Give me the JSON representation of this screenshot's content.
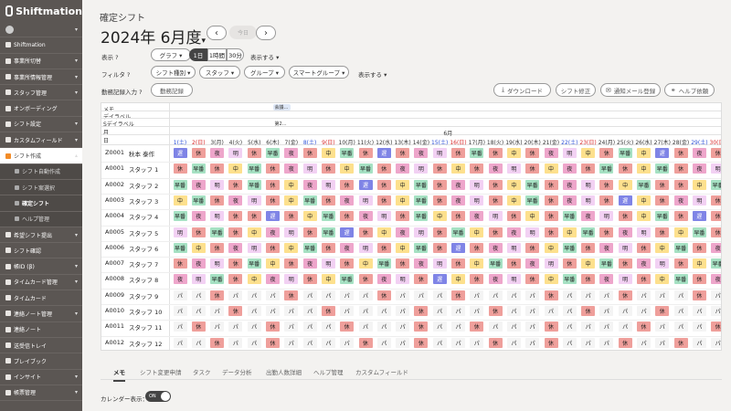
{
  "sidebar": {
    "brand": "Shiftmation",
    "items": [
      {
        "label": "",
        "kind": "avatar",
        "chev": "▾"
      },
      {
        "label": "Shiftmation",
        "chev": ""
      },
      {
        "label": "事業所切替",
        "chev": "▾"
      },
      {
        "label": "事業所情報管理",
        "chev": "▾"
      },
      {
        "label": "スタッフ管理",
        "chev": "▾"
      },
      {
        "label": "オンボーディング",
        "chev": ""
      },
      {
        "label": "シフト設定",
        "chev": "▾"
      },
      {
        "label": "カスタムフィールド",
        "chev": "▾"
      },
      {
        "label": "シフト作成",
        "chev": "▴",
        "kind": "active"
      },
      {
        "label": "シフト自動作成",
        "kind": "sub"
      },
      {
        "label": "シフト案選択",
        "kind": "sub"
      },
      {
        "label": "確定シフト",
        "kind": "sub cur"
      },
      {
        "label": "ヘルプ管理",
        "kind": "sub"
      },
      {
        "label": "希望シフト提出",
        "chev": "▾"
      },
      {
        "label": "シフト確認",
        "chev": ""
      },
      {
        "label": "帳ID (β)",
        "chev": "▾"
      },
      {
        "label": "タイムカード管理",
        "chev": "▾"
      },
      {
        "label": "タイムカード",
        "chev": ""
      },
      {
        "label": "連絡ノート管理",
        "chev": "▾"
      },
      {
        "label": "連絡ノート",
        "chev": ""
      },
      {
        "label": "送受信トレイ",
        "chev": ""
      },
      {
        "label": "プレイブック",
        "chev": ""
      },
      {
        "label": "インサイト",
        "chev": "▾"
      },
      {
        "label": "帳票管理",
        "chev": "▾"
      }
    ]
  },
  "header": {
    "page_title": "確定シフト",
    "period": "2024年 6月度",
    "period_caret": "▾",
    "prev": "‹",
    "next": "›",
    "today": "今日"
  },
  "display": {
    "label": "表示 ?",
    "graph": "グラフ ▾",
    "seg_1day": "1日",
    "seg_1hour": "1時間",
    "seg_30min": "30分",
    "show": "表示する ▾"
  },
  "filter": {
    "label": "フィルタ ?",
    "shift_type": "シフト種別 ▾",
    "staff": "スタッフ ▾",
    "group": "グループ ▾",
    "smart_group": "スマートグループ ▾",
    "show": "表示する ▾"
  },
  "attendance": {
    "label": "勤務記録入力 ?",
    "auto": "勤務記録"
  },
  "actions": {
    "download": "ダウンロード",
    "shift_fix": "シフト修正",
    "notify": "通知メール登録",
    "help": "ヘルプ依頼"
  },
  "grid": {
    "row_labels": [
      "メモ",
      "デイラベル",
      "Sデイラベル",
      "月",
      "日"
    ],
    "memo_tag": "会議…",
    "sday_tag": "第2…",
    "month": "6月",
    "days": [
      {
        "label": "1(土)",
        "kind": "sat"
      },
      {
        "label": "2(日)",
        "kind": "sun"
      },
      {
        "label": "3(月)",
        "kind": ""
      },
      {
        "label": "4(火)",
        "kind": ""
      },
      {
        "label": "5(水)",
        "kind": ""
      },
      {
        "label": "6(木)",
        "kind": ""
      },
      {
        "label": "7(金)",
        "kind": ""
      },
      {
        "label": "8(土)",
        "kind": "sat"
      },
      {
        "label": "9(日)",
        "kind": "sun"
      },
      {
        "label": "10(月)",
        "kind": ""
      },
      {
        "label": "11(火)",
        "kind": ""
      },
      {
        "label": "12(水)",
        "kind": ""
      },
      {
        "label": "13(木)",
        "kind": ""
      },
      {
        "label": "14(金)",
        "kind": ""
      },
      {
        "label": "15(土)",
        "kind": "sat"
      },
      {
        "label": "16(日)",
        "kind": "sun"
      },
      {
        "label": "17(月)",
        "kind": ""
      },
      {
        "label": "18(火)",
        "kind": ""
      },
      {
        "label": "19(水)",
        "kind": ""
      },
      {
        "label": "20(木)",
        "kind": ""
      },
      {
        "label": "21(金)",
        "kind": ""
      },
      {
        "label": "22(土)",
        "kind": "sat"
      },
      {
        "label": "23(日)",
        "kind": "sun"
      },
      {
        "label": "24(月)",
        "kind": ""
      },
      {
        "label": "25(火)",
        "kind": ""
      },
      {
        "label": "26(水)",
        "kind": ""
      },
      {
        "label": "27(木)",
        "kind": ""
      },
      {
        "label": "28(金)",
        "kind": ""
      },
      {
        "label": "29(土)",
        "kind": "sat"
      },
      {
        "label": "30(日)",
        "kind": "sun"
      }
    ],
    "staff": [
      {
        "code": "Z0001",
        "name": "秋本 泰作",
        "shifts": [
          "遅",
          "休",
          "夜",
          "明",
          "休",
          "早番",
          "夜",
          "休",
          "中",
          "早番",
          "休",
          "遅",
          "休",
          "夜",
          "明",
          "休",
          "早番",
          "休",
          "中",
          "休",
          "夜",
          "明",
          "中",
          "休",
          "早番",
          "中",
          "遅",
          "休",
          "夜",
          "休"
        ]
      },
      {
        "code": "A0001",
        "name": "スタッフ 1",
        "shifts": [
          "休",
          "早番",
          "休",
          "中",
          "早番",
          "休",
          "夜",
          "明",
          "休",
          "中",
          "早番",
          "休",
          "夜",
          "明",
          "休",
          "中",
          "休",
          "夜",
          "明",
          "休",
          "中",
          "夜",
          "休",
          "早番",
          "休",
          "中",
          "早番",
          "休",
          "夜",
          "明"
        ]
      },
      {
        "code": "A0002",
        "name": "スタッフ 2",
        "shifts": [
          "早番",
          "夜",
          "明",
          "休",
          "早番",
          "休",
          "中",
          "夜",
          "明",
          "休",
          "遅",
          "休",
          "中",
          "早番",
          "休",
          "夜",
          "明",
          "休",
          "中",
          "早番",
          "休",
          "夜",
          "明",
          "休",
          "中",
          "早番",
          "休",
          "休",
          "中",
          "早番"
        ]
      },
      {
        "code": "A0003",
        "name": "スタッフ 3",
        "shifts": [
          "中",
          "早番",
          "休",
          "夜",
          "明",
          "休",
          "中",
          "早番",
          "休",
          "夜",
          "明",
          "休",
          "中",
          "早番",
          "休",
          "夜",
          "明",
          "休",
          "中",
          "早番",
          "休",
          "夜",
          "明",
          "休",
          "遅",
          "中",
          "休",
          "夜",
          "明",
          "休"
        ]
      },
      {
        "code": "A0004",
        "name": "スタッフ 4",
        "shifts": [
          "早番",
          "夜",
          "明",
          "休",
          "休",
          "遅",
          "休",
          "中",
          "早番",
          "休",
          "夜",
          "明",
          "休",
          "早番",
          "中",
          "休",
          "夜",
          "明",
          "休",
          "中",
          "休",
          "早番",
          "夜",
          "明",
          "休",
          "中",
          "早番",
          "休",
          "遅",
          "休"
        ]
      },
      {
        "code": "A0005",
        "name": "スタッフ 5",
        "shifts": [
          "明",
          "休",
          "早番",
          "休",
          "中",
          "夜",
          "明",
          "休",
          "早番",
          "遅",
          "休",
          "中",
          "夜",
          "明",
          "休",
          "早番",
          "中",
          "休",
          "夜",
          "明",
          "休",
          "中",
          "早番",
          "休",
          "夜",
          "明",
          "休",
          "中",
          "早番",
          "休"
        ]
      },
      {
        "code": "A0006",
        "name": "スタッフ 6",
        "shifts": [
          "早番",
          "中",
          "休",
          "夜",
          "明",
          "休",
          "中",
          "早番",
          "休",
          "夜",
          "明",
          "休",
          "中",
          "早番",
          "休",
          "遅",
          "休",
          "夜",
          "明",
          "休",
          "中",
          "早番",
          "休",
          "夜",
          "明",
          "休",
          "中",
          "早番",
          "休",
          "夜"
        ]
      },
      {
        "code": "A0007",
        "name": "スタッフ 7",
        "shifts": [
          "休",
          "夜",
          "明",
          "休",
          "早番",
          "中",
          "休",
          "夜",
          "明",
          "休",
          "中",
          "早番",
          "休",
          "夜",
          "明",
          "休",
          "中",
          "早番",
          "休",
          "夜",
          "明",
          "休",
          "中",
          "早番",
          "休",
          "夜",
          "明",
          "休",
          "中",
          "早番"
        ]
      },
      {
        "code": "A0008",
        "name": "スタッフ 8",
        "shifts": [
          "夜",
          "明",
          "早番",
          "休",
          "中",
          "夜",
          "明",
          "休",
          "中",
          "早番",
          "休",
          "夜",
          "明",
          "休",
          "遅",
          "中",
          "休",
          "夜",
          "明",
          "休",
          "中",
          "早番",
          "休",
          "夜",
          "明",
          "休",
          "中",
          "早番",
          "休",
          "夜"
        ]
      },
      {
        "code": "A0009",
        "name": "スタッフ 9",
        "shifts": [
          "パ",
          "パ",
          "休",
          "パ",
          "パ",
          "パ",
          "休",
          "パ",
          "パ",
          "パ",
          "パ",
          "休",
          "パ",
          "パ",
          "パ",
          "休",
          "パ",
          "パ",
          "パ",
          "パ",
          "休",
          "パ",
          "パ",
          "パ",
          "休",
          "パ",
          "パ",
          "パ",
          "休",
          "パ"
        ]
      },
      {
        "code": "A0010",
        "name": "スタッフ 10",
        "shifts": [
          "パ",
          "パ",
          "パ",
          "休",
          "パ",
          "パ",
          "パ",
          "パ",
          "休",
          "パ",
          "パ",
          "パ",
          "パ",
          "休",
          "パ",
          "パ",
          "パ",
          "休",
          "パ",
          "パ",
          "パ",
          "パ",
          "休",
          "パ",
          "パ",
          "パ",
          "休",
          "パ",
          "パ",
          "パ"
        ]
      },
      {
        "code": "A0011",
        "name": "スタッフ 11",
        "shifts": [
          "パ",
          "休",
          "パ",
          "パ",
          "パ",
          "休",
          "パ",
          "パ",
          "パ",
          "休",
          "パ",
          "パ",
          "パ",
          "休",
          "パ",
          "パ",
          "休",
          "パ",
          "パ",
          "パ",
          "休",
          "パ",
          "パ",
          "パ",
          "パ",
          "休",
          "パ",
          "パ",
          "パ",
          "休"
        ]
      },
      {
        "code": "A0012",
        "name": "スタッフ 12",
        "shifts": [
          "パ",
          "パ",
          "休",
          "パ",
          "パ",
          "休",
          "パ",
          "パ",
          "パ",
          "パ",
          "休",
          "パ",
          "パ",
          "休",
          "パ",
          "パ",
          "パ",
          "休",
          "パ",
          "パ",
          "休",
          "パ",
          "パ",
          "パ",
          "休",
          "パ",
          "パ",
          "休",
          "パ",
          "パ"
        ]
      }
    ],
    "shift_colors": {
      "休": "#ef9f9b",
      "早番": "#a6e1c3",
      "中": "#fde08d",
      "夜": "#eea6cb",
      "明": "#f2d1f3",
      "遅": "#7f84e6",
      "パ": "#f4f4f4"
    }
  },
  "tabs": [
    "メモ",
    "シフト変更申請",
    "タスク",
    "データ分析",
    "出勤人数詳細",
    "ヘルプ管理",
    "カスタムフィールド"
  ],
  "calendar": {
    "label": "カレンダー表示：",
    "toggle": "ON"
  }
}
